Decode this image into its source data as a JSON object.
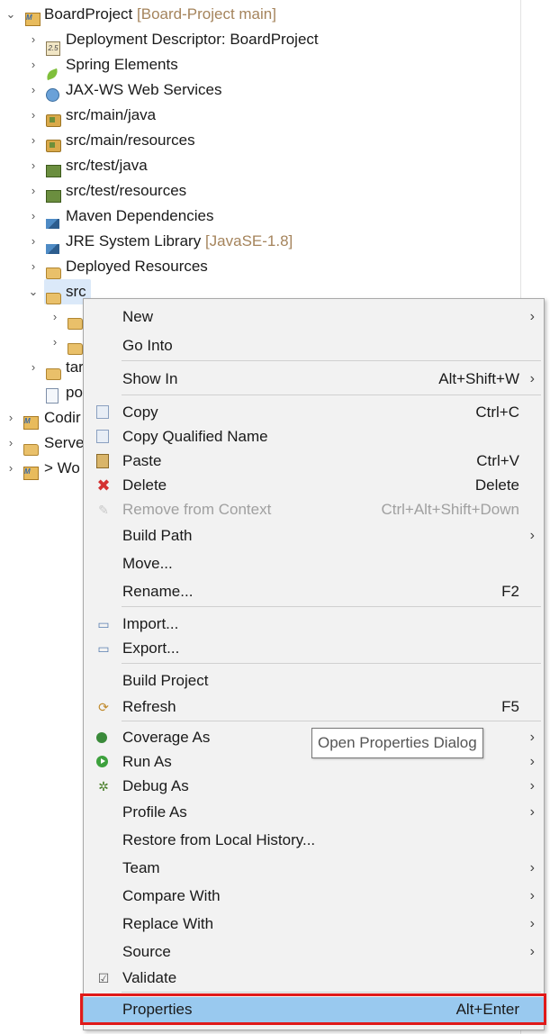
{
  "tree": {
    "root": {
      "label": "BoardProject",
      "decoration": "[Board-Project main]"
    },
    "children": [
      {
        "label": "Deployment Descriptor: BoardProject",
        "icon": "deployment-descriptor-icon"
      },
      {
        "label": "Spring Elements",
        "icon": "spring-leaf-icon"
      },
      {
        "label": "JAX-WS Web Services",
        "icon": "web-services-icon"
      },
      {
        "label": "src/main/java",
        "icon": "source-folder-icon"
      },
      {
        "label": "src/main/resources",
        "icon": "source-folder-icon"
      },
      {
        "label": "src/test/java",
        "icon": "source-folder-icon"
      },
      {
        "label": "src/test/resources",
        "icon": "source-folder-icon"
      },
      {
        "label": "Maven Dependencies",
        "icon": "library-icon"
      },
      {
        "label": "JRE System Library",
        "decoration": "[JavaSE-1.8]",
        "icon": "library-icon"
      },
      {
        "label": "Deployed Resources",
        "icon": "globe-folder-icon"
      },
      {
        "label": "src",
        "icon": "folder-icon"
      },
      {
        "label": "tar",
        "icon": "folder-icon"
      },
      {
        "label": "po",
        "icon": "file-icon"
      }
    ],
    "others": [
      {
        "label": "Codir"
      },
      {
        "label": "Serve"
      },
      {
        "label": "> Wo"
      }
    ]
  },
  "menu": {
    "new": "New",
    "go_into": "Go Into",
    "show_in": "Show In",
    "show_in_shortcut": "Alt+Shift+W",
    "copy": "Copy",
    "copy_shortcut": "Ctrl+C",
    "copy_qualified": "Copy Qualified Name",
    "paste": "Paste",
    "paste_shortcut": "Ctrl+V",
    "delete": "Delete",
    "delete_shortcut": "Delete",
    "remove_context": "Remove from Context",
    "remove_context_shortcut": "Ctrl+Alt+Shift+Down",
    "build_path": "Build Path",
    "move": "Move...",
    "rename": "Rename...",
    "rename_shortcut": "F2",
    "import": "Import...",
    "export": "Export...",
    "build_project": "Build Project",
    "refresh": "Refresh",
    "refresh_shortcut": "F5",
    "coverage_as": "Coverage As",
    "run_as": "Run As",
    "debug_as": "Debug As",
    "profile_as": "Profile As",
    "restore_history": "Restore from Local History...",
    "team": "Team",
    "compare_with": "Compare With",
    "replace_with": "Replace With",
    "source": "Source",
    "validate": "Validate",
    "properties": "Properties",
    "properties_shortcut": "Alt+Enter"
  },
  "tooltip": "Open Properties Dialog",
  "glyphs": {
    "expanded": "⌄",
    "collapsed": "›",
    "submenu": "›",
    "delete": "✖",
    "check": "☑"
  }
}
